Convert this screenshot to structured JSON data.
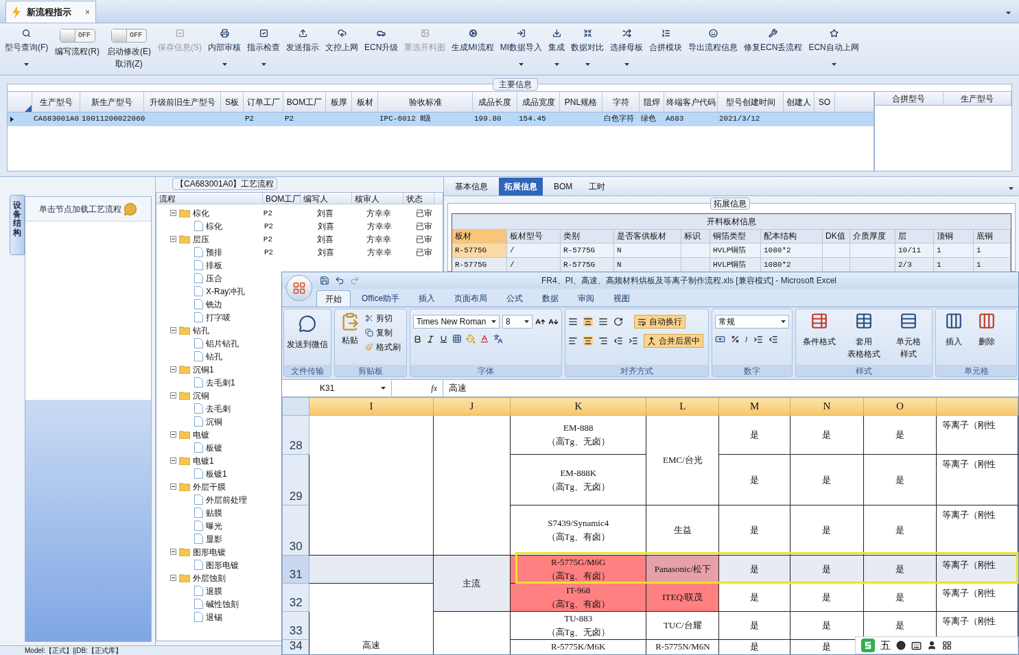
{
  "window": {
    "tab": "新流程指示",
    "close": "×"
  },
  "toolbar": [
    {
      "label": "型号查询(F)",
      "kind": "button",
      "caret": true,
      "disabled": false
    },
    {
      "label": "编写流程(R)",
      "kind": "toggle",
      "on": false,
      "state_text": "OFF"
    },
    {
      "label": "启动修改(E)",
      "label2": "取消(Z)",
      "kind": "toggle",
      "on": false,
      "state_text": "OFF"
    },
    {
      "label": "保存信息(S)",
      "kind": "button",
      "disabled": true
    },
    {
      "label": "内部审核",
      "kind": "button",
      "caret": true,
      "disabled": false
    },
    {
      "label": "指示检查",
      "kind": "button",
      "caret": true,
      "disabled": false
    },
    {
      "label": "发送指示",
      "kind": "button",
      "disabled": false
    },
    {
      "label": "文控上网",
      "kind": "button",
      "disabled": false
    },
    {
      "label": "ECN升级",
      "kind": "button",
      "disabled": false
    },
    {
      "label": "重选开料图",
      "kind": "button",
      "disabled": true
    },
    {
      "label": "生成MI流程",
      "kind": "button",
      "disabled": false
    },
    {
      "label": "MI数据导入",
      "kind": "button",
      "caret": true,
      "disabled": false
    },
    {
      "label": "集成",
      "kind": "button",
      "caret": true,
      "disabled": false
    },
    {
      "label": "数据对比",
      "kind": "button",
      "caret": true,
      "disabled": false
    },
    {
      "label": "选择母板",
      "kind": "button",
      "caret": true,
      "disabled": false
    },
    {
      "label": "合拼模块",
      "kind": "button",
      "disabled": false
    },
    {
      "label": "导出流程信息",
      "kind": "button",
      "disabled": false
    },
    {
      "label": "修复ECN丢流程",
      "kind": "button",
      "disabled": false
    },
    {
      "label": "ECN自动上网",
      "kind": "button",
      "caret": true,
      "disabled": false
    }
  ],
  "main_info": {
    "title": "主要信息",
    "columns": [
      "生产型号",
      "新生产型号",
      "升级前旧生产型号",
      "S板",
      "订单工厂",
      "BOM工厂",
      "板厚",
      "板材",
      "验收标准",
      "成品长度",
      "成品宽度",
      "PNL规格",
      "字符",
      "阻焊",
      "终端客户代码",
      "型号创建时间",
      "创建人",
      "SO"
    ],
    "rows": [
      {
        "selected": true,
        "cells": [
          "CA683001A0",
          "10011200022060",
          null,
          null,
          "P2",
          "P2",
          null,
          null,
          "IPC-6012 Ⅱ级",
          "199.80",
          "154.45",
          null,
          "白色字符",
          "绿色",
          "A683",
          "2021/3/12",
          null,
          null
        ]
      }
    ],
    "side_columns": [
      "合拼型号",
      "生产型号"
    ]
  },
  "left_panel": {
    "vertical_tab": "设备结构",
    "header": "单击节点加载工艺流程"
  },
  "process": {
    "title": "【CA683001A0】工艺流程",
    "columns": [
      "流程",
      "BOM工厂",
      "编写人",
      "核审人",
      "状态"
    ],
    "tree": [
      {
        "label": "棕化",
        "expanded": true,
        "values": [
          "P2",
          "刘喜",
          "方幸幸",
          "已审"
        ],
        "children": [
          {
            "label": "棕化",
            "values": [
              "P2",
              "刘喜",
              "方幸幸",
              "已审"
            ]
          }
        ]
      },
      {
        "label": "层压",
        "expanded": true,
        "values": [
          "P2",
          "刘喜",
          "方幸幸",
          "已审"
        ],
        "children": [
          {
            "label": "预排",
            "values": [
              "P2",
              "刘喜",
              "方幸幸",
              "已审"
            ]
          },
          {
            "label": "排板"
          },
          {
            "label": "压合"
          },
          {
            "label": "X-Ray冲孔"
          },
          {
            "label": "铣边"
          },
          {
            "label": "打字唛"
          }
        ]
      },
      {
        "label": "钻孔",
        "expanded": true,
        "children": [
          {
            "label": "铝片钻孔"
          },
          {
            "label": "钻孔"
          }
        ]
      },
      {
        "label": "沉铜1",
        "expanded": true,
        "children": [
          {
            "label": "去毛刺1"
          }
        ]
      },
      {
        "label": "沉铜",
        "expanded": true,
        "children": [
          {
            "label": "去毛刺"
          },
          {
            "label": "沉铜"
          }
        ]
      },
      {
        "label": "电镀",
        "expanded": true,
        "children": [
          {
            "label": "板镀"
          }
        ]
      },
      {
        "label": "电镀1",
        "expanded": true,
        "children": [
          {
            "label": "板镀1"
          }
        ]
      },
      {
        "label": "外层干膜",
        "expanded": true,
        "children": [
          {
            "label": "外层前处理"
          },
          {
            "label": "贴膜"
          },
          {
            "label": "曝光"
          },
          {
            "label": "显影"
          }
        ]
      },
      {
        "label": "图形电镀",
        "expanded": true,
        "children": [
          {
            "label": "图形电镀"
          }
        ]
      },
      {
        "label": "外层蚀刻",
        "expanded": true,
        "children": [
          {
            "label": "退膜"
          },
          {
            "label": "碱性蚀刻"
          },
          {
            "label": "退锡"
          }
        ]
      }
    ]
  },
  "detail_tabs": [
    {
      "label": "基本信息",
      "selected": false
    },
    {
      "label": "拓展信息",
      "selected": true
    },
    {
      "label": "BOM",
      "selected": false
    },
    {
      "label": "工时",
      "selected": false
    }
  ],
  "ext_info": {
    "title": "拓展信息",
    "table_title": "开料板材信息",
    "columns": [
      "板材",
      "板材型号",
      "类别",
      "是否客供板材",
      "标识",
      "铜箔类型",
      "配本结构",
      "DK值",
      "介质厚度",
      "层",
      "顶铜",
      "底铜"
    ],
    "rows": [
      {
        "selected": true,
        "cells": [
          "R-5775G",
          "/",
          "R-5775G",
          "N",
          null,
          "HVLP铜箔",
          "1080*2",
          null,
          null,
          "10/11",
          "1",
          "1"
        ]
      },
      {
        "selected": false,
        "cells": [
          "R-5775G",
          "/",
          "R-5775G",
          "N",
          null,
          "HVLP铜箔",
          "1080*2",
          null,
          null,
          "2/3",
          "1",
          "1"
        ]
      }
    ]
  },
  "status_bar": "Model:【正式】||DB:【正式库】",
  "excel": {
    "title": "FR4、PI、高速、高频材料烘板及等离子制作流程.xls  [兼容模式] - Microsoft Excel",
    "tabs": [
      {
        "label": "开始",
        "selected": true
      },
      {
        "label": "Office助手",
        "selected": false
      },
      {
        "label": "插入",
        "selected": false
      },
      {
        "label": "页面布局",
        "selected": false
      },
      {
        "label": "公式",
        "selected": false
      },
      {
        "label": "数据",
        "selected": false
      },
      {
        "label": "审阅",
        "selected": false
      },
      {
        "label": "视图",
        "selected": false
      }
    ],
    "ribbon": {
      "send_wechat": "发送到微信",
      "group_file": "文件传输",
      "paste": "粘贴",
      "cut": "剪切",
      "copy": "复制",
      "format_painter": "格式刷",
      "group_clipboard": "剪贴板",
      "font_name": "Times New Roman",
      "font_size": "8",
      "group_font": "字体",
      "wrap": "自动换行",
      "merge": "合并后居中",
      "group_align": "对齐方式",
      "number_format": "常规",
      "group_number": "数字",
      "cond_format": "条件格式",
      "table_format": "套用",
      "table_format2": "表格格式",
      "cell_style": "单元格",
      "cell_style2": "样式",
      "group_style": "样式",
      "insert": "插入",
      "delete": "删除",
      "group_cells": "单元格"
    },
    "name_box": "K31",
    "fx": "fx",
    "formula": "高速",
    "columns": [
      "I",
      "J",
      "K",
      "L",
      "M",
      "N",
      "O"
    ],
    "rows": [
      {
        "number": "28",
        "selected": false,
        "cells": [
          {
            "rowspan": 3
          },
          {
            "rowspan": 3
          },
          {
            "lines": [
              "EM-888",
              "（高Tg、无卤）"
            ]
          },
          {
            "lines": [
              "EMC/台光"
            ],
            "rowspan": 2
          },
          {
            "lines": [
              "是"
            ]
          },
          {
            "lines": [
              "是"
            ]
          },
          {
            "lines": [
              "是"
            ]
          },
          {
            "lines": [
              "等离子（刚性"
            ],
            "kind": "note"
          }
        ]
      },
      {
        "number": "29",
        "selected": false,
        "cells": [
          {
            "lines": [
              "EM-888K",
              "（高Tg、无卤）"
            ]
          },
          {
            "lines": [
              "是"
            ]
          },
          {
            "lines": [
              "是"
            ]
          },
          {
            "lines": [
              "是"
            ]
          },
          {
            "lines": [
              "等离子（刚性"
            ],
            "kind": "note"
          }
        ]
      },
      {
        "number": "30",
        "selected": false,
        "cells": [
          {
            "lines": [
              "S7439/Synamic4",
              "（高Tg、有卤）"
            ]
          },
          {
            "lines": [
              "生益"
            ]
          },
          {
            "lines": [
              "是"
            ]
          },
          {
            "lines": [
              "是"
            ]
          },
          {
            "lines": [
              "是"
            ]
          },
          {
            "lines": [
              "等离子（刚性"
            ],
            "kind": "note"
          }
        ]
      },
      {
        "number": "31",
        "selected": true,
        "cells": [
          {},
          {
            "lines": [
              "主流"
            ],
            "rowspan": 2
          },
          {
            "lines": [
              "R-5775G/M6G",
              "（高Tg、有卤）"
            ],
            "color": "#ff8080"
          },
          {
            "lines": [
              "Panasonic/松下"
            ],
            "color": "#e6a0aa"
          },
          {
            "lines": [
              "是"
            ]
          },
          {
            "lines": [
              "是"
            ]
          },
          {
            "lines": [
              "是"
            ]
          },
          {
            "lines": [
              "等离子（刚性"
            ],
            "kind": "note"
          }
        ]
      },
      {
        "number": "32",
        "selected": false,
        "cells": [
          {
            "lines": [
              "高速"
            ],
            "rowspan": 3,
            "kind": "bottom"
          },
          {
            "lines": [
              "IT-968",
              "（高Tg、有卤）"
            ],
            "color": "#ff8080"
          },
          {
            "lines": [
              "ITEQ/联茂"
            ],
            "color": "#ff8080"
          },
          {
            "lines": [
              "是"
            ]
          },
          {
            "lines": [
              "是"
            ]
          },
          {
            "lines": [
              "是"
            ]
          },
          {
            "lines": [
              "等离子（刚性"
            ],
            "kind": "note"
          }
        ]
      },
      {
        "number": "33",
        "selected": false,
        "cells": [
          {
            "rowspan": 2
          },
          {
            "lines": [
              "TU-883",
              "（高Tg、无卤）"
            ]
          },
          {
            "lines": [
              "TUC/台耀"
            ]
          },
          {
            "lines": [
              "是"
            ]
          },
          {
            "lines": [
              "是"
            ]
          },
          {
            "lines": [
              "是"
            ]
          },
          {
            "lines": [
              "等离子（刚性"
            ],
            "kind": "note"
          }
        ]
      },
      {
        "number": "34",
        "selected": false,
        "cells": [
          {
            "lines": [
              "R-5775K/M6K"
            ]
          },
          {
            "lines": [
              "R-5775N/M6N"
            ]
          },
          {
            "lines": [
              "是"
            ]
          },
          {
            "lines": [
              "是"
            ]
          }
        ]
      }
    ]
  },
  "ime_bar": {
    "mode": "五"
  }
}
